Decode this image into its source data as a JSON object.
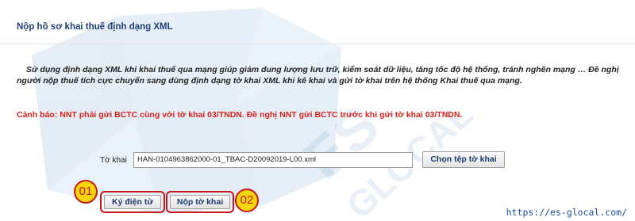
{
  "page": {
    "title": "Nộp hồ sơ khai thuế định dạng XML"
  },
  "intro": {
    "text": "Sử dụng định dạng XML khi khai thuế qua mạng giúp giảm dung lượng lưu trữ, kiểm soát dữ liệu, tăng tốc độ hệ thống, tránh nghẽn mạng … Đề nghị người nộp thuế tích cực chuyển sang dùng định dạng tờ khai XML khi kê khai và gửi tờ khai trên hệ thống Khai thuế qua mạng."
  },
  "warning": {
    "text": "Cảnh báo: NNT phải gửi BCTC cùng với tờ khai 03/TNDN. Đề nghị NNT gửi BCTC trước khi gửi tờ khai 03/TNDN.",
    "color": "#d9221c"
  },
  "form": {
    "file_label": "Tờ khai",
    "file_value": "HAN-0104963862000-01_TBAC-D20092019-L00.xml",
    "choose_button": "Chọn tệp tờ khai"
  },
  "actions": {
    "sign_button": "Ký điện tử",
    "submit_button": "Nộp tờ khai"
  },
  "annotations": {
    "badge_1": "01",
    "badge_2": "02",
    "badge_color": "#f5d60b",
    "highlight_color": "#c4171d"
  },
  "watermark": {
    "site": "https://es-glocal.com/"
  },
  "colors": {
    "title": "#1f3f76",
    "button_text": "#1a3a6e"
  }
}
